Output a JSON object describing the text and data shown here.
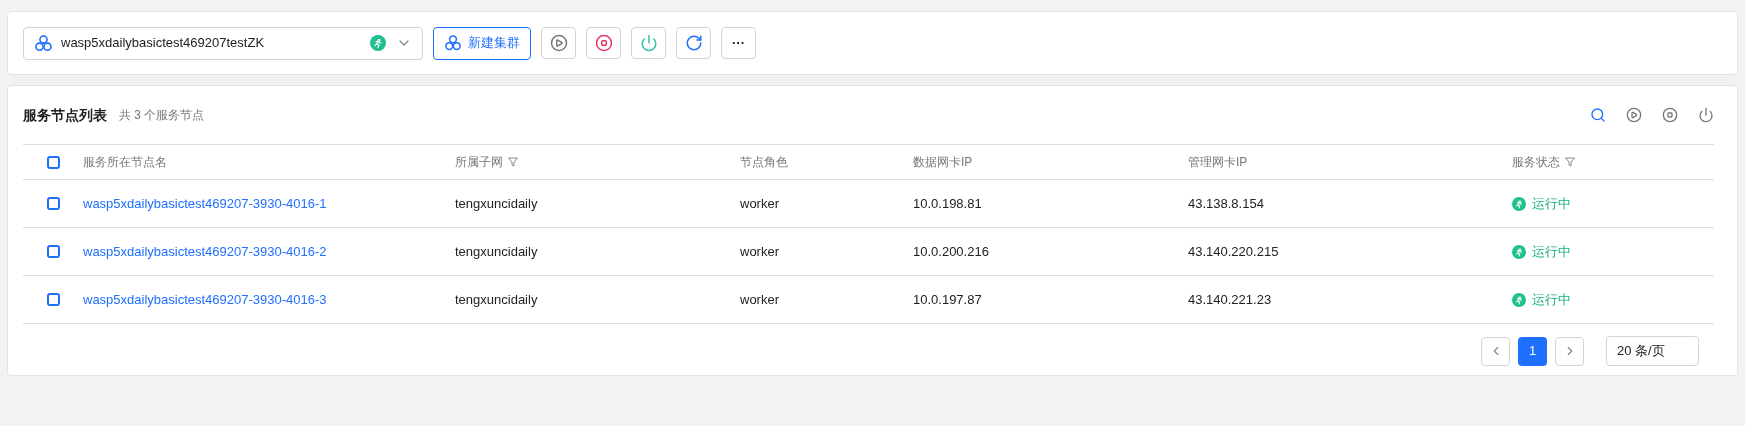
{
  "cluster_select": {
    "value": "wasp5xdailybasictest469207testZK"
  },
  "toolbar": {
    "new_cluster_label": "新建集群",
    "more_label": "···"
  },
  "panel": {
    "title": "服务节点列表",
    "count": "共 3 个服务节点"
  },
  "table": {
    "header_checked": false,
    "columns": [
      {
        "label": "服务所在节点名",
        "filter": false
      },
      {
        "label": "所属子网",
        "filter": true
      },
      {
        "label": "节点角色",
        "filter": false
      },
      {
        "label": "数据网卡IP",
        "filter": false
      },
      {
        "label": "管理网卡IP",
        "filter": false
      },
      {
        "label": "服务状态",
        "filter": true
      }
    ],
    "rows": [
      {
        "checked": false,
        "name": "wasp5xdailybasictest469207-3930-4016-1",
        "subnet": "tengxuncidaily",
        "role": "worker",
        "data_ip": "10.0.198.81",
        "mgmt_ip": "43.138.8.154",
        "status": "运行中"
      },
      {
        "checked": false,
        "name": "wasp5xdailybasictest469207-3930-4016-2",
        "subnet": "tengxuncidaily",
        "role": "worker",
        "data_ip": "10.0.200.216",
        "mgmt_ip": "43.140.220.215",
        "status": "运行中"
      },
      {
        "checked": false,
        "name": "wasp5xdailybasictest469207-3930-4016-3",
        "subnet": "tengxuncidaily",
        "role": "worker",
        "data_ip": "10.0.197.87",
        "mgmt_ip": "43.140.221.23",
        "status": "运行中"
      }
    ]
  },
  "pagination": {
    "pages": [
      {
        "label": "1",
        "selected": true
      }
    ],
    "page_size": "20 条/页"
  }
}
